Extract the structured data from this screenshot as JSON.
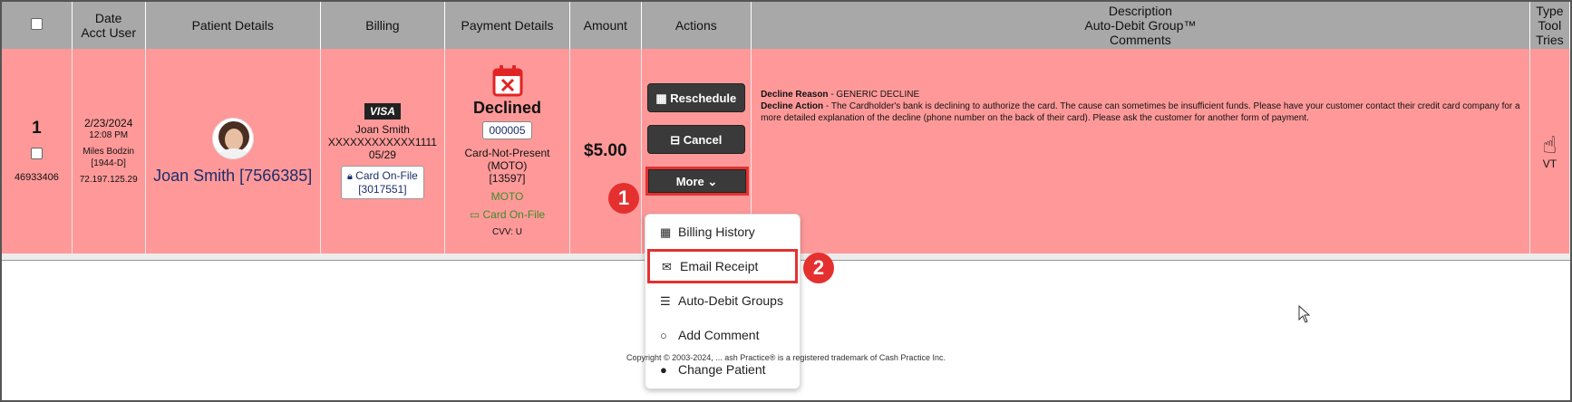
{
  "headers": {
    "date": [
      "Date",
      "Acct User"
    ],
    "patient": "Patient Details",
    "billing": "Billing",
    "payment": "Payment Details",
    "amount": "Amount",
    "actions": "Actions",
    "description": [
      "Description",
      "Auto-Debit Group™",
      "Comments"
    ],
    "type": [
      "Type",
      "Tool",
      "Tries"
    ]
  },
  "row": {
    "number": "1",
    "id": "46933406",
    "date": "2/23/2024",
    "time": "12:08 PM",
    "user": "Miles Bodzin",
    "user_code": "[1944-D]",
    "ip": "72.197.125.29",
    "patient_name": "Joan Smith [7566385]",
    "card_brand": "VISA",
    "card_name": "Joan Smith",
    "card_number": "XXXXXXXXXXXX1111",
    "card_exp": "05/29",
    "card_on_file_label": "Card On-File",
    "card_on_file_id": "[3017551]",
    "status": "Declined",
    "status_code": "000005",
    "payment_type": "Card-Not-Present",
    "payment_mode": "(MOTO)",
    "payment_ref": "[13597]",
    "moto": "MOTO",
    "card_on_file_green": "Card On-File",
    "cvv": "CVV: U",
    "amount": "$5.00",
    "decline_reason_label": "Decline Reason",
    "decline_reason": " - GENERIC DECLINE",
    "decline_action_label": "Decline Action",
    "decline_action": " - The Cardholder's bank is declining to authorize the card. The cause can sometimes be insufficient funds. Please have your customer contact their credit card company for a more detailed explanation of the decline (phone number on the back of their card). Please ask the customer for another form of payment.",
    "tool": "VT"
  },
  "actions": {
    "reschedule": "Reschedule",
    "cancel": "Cancel",
    "more": "More"
  },
  "menu": [
    {
      "label": "Billing History",
      "icon": "calendar-icon"
    },
    {
      "label": "Email Receipt",
      "icon": "envelope-icon"
    },
    {
      "label": "Auto-Debit Groups",
      "icon": "group-icon"
    },
    {
      "label": "Add Comment",
      "icon": "comment-icon"
    },
    {
      "label": "Change Patient",
      "icon": "user-icon"
    }
  ],
  "markers": [
    "1",
    "2"
  ],
  "footer": "Copyright © 2003-2024, ... ash Practice® is a registered trademark of Cash Practice Inc.",
  "colors": {
    "row_bg": "#ff9999",
    "header_bg": "#a8a8a8",
    "highlight": "#e53030",
    "link": "#1c2d6b",
    "green": "#3f8a2a"
  }
}
